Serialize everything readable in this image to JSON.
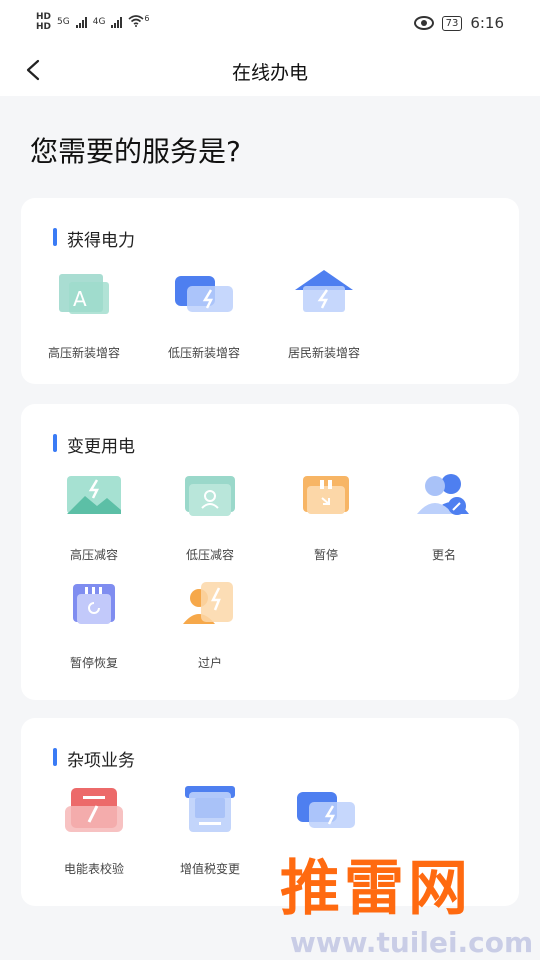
{
  "status_bar": {
    "hd1": "HD",
    "hd2": "HD",
    "net1": "5G",
    "net2": "4G",
    "wifi": "6",
    "battery": "73",
    "time": "6:16"
  },
  "nav": {
    "title": "在线办电"
  },
  "question": "您需要的服务是?",
  "sections": {
    "power": {
      "title": "获得电力",
      "items": [
        "高压新装增容",
        "低压新装增容",
        "居民新装增容"
      ]
    },
    "change": {
      "title": "变更用电",
      "items": [
        "高压减容",
        "低压减容",
        "暂停",
        "更名",
        "暂停恢复",
        "过户"
      ]
    },
    "misc": {
      "title": "杂项业务",
      "items": [
        "电能表校验",
        "增值税变更",
        ""
      ]
    }
  },
  "watermark": {
    "big": "推雷网",
    "small": "www.tuilei.com"
  },
  "colors": {
    "accent": "#3a7bf5",
    "background": "#f5f6f8",
    "watermark": "#ff6a10"
  }
}
